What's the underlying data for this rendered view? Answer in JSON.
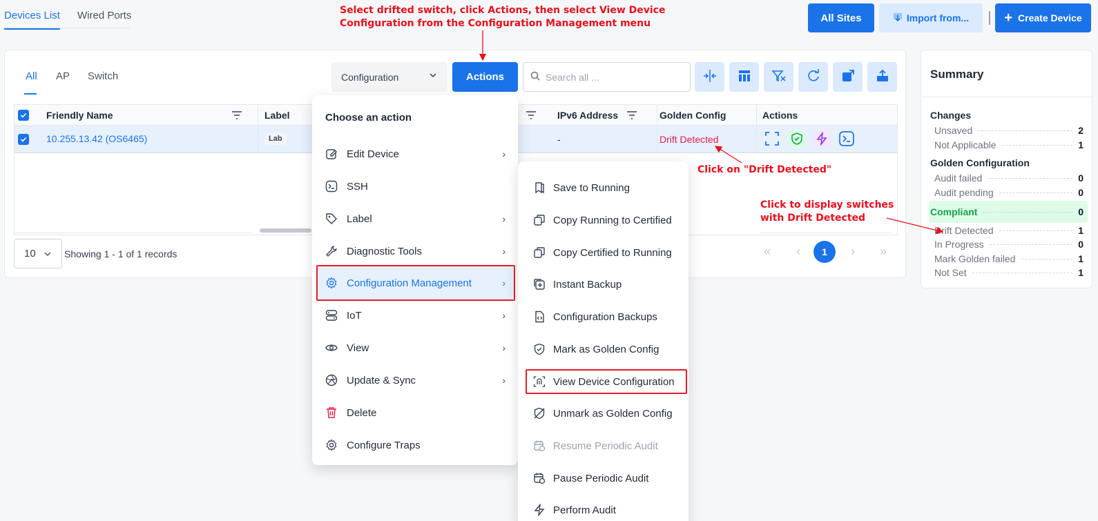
{
  "top_tabs": [
    {
      "label": "Devices List"
    },
    {
      "label": "Wired Ports"
    }
  ],
  "header_buttons": {
    "all_sites": "All Sites",
    "import": "Import from...",
    "create": "Create Device"
  },
  "sub_tabs": [
    {
      "label": "All"
    },
    {
      "label": "AP"
    },
    {
      "label": "Switch"
    }
  ],
  "toolbar": {
    "view_select": "Configuration",
    "actions_label": "Actions",
    "search_placeholder": "Search all ...",
    "tools": [
      "collapse-columns-icon",
      "columns-layout-icon",
      "clear-filter-icon",
      "refresh-icon",
      "open-external-icon",
      "export-icon"
    ]
  },
  "table": {
    "headers": {
      "friendly_name": "Friendly Name",
      "label": "Label",
      "ipv6": "IPv6 Address",
      "golden": "Golden Config",
      "actions": "Actions"
    },
    "rows": [
      {
        "friendly_name": "10.255.13.42 (OS6465)",
        "label": "Lab",
        "ipv6": "-",
        "golden": "Drift Detected"
      }
    ]
  },
  "pagination": {
    "page_size": "10",
    "showing": "Showing 1 - 1 of 1 records",
    "current_page": "1"
  },
  "summary": {
    "title": "Summary",
    "changes_heading": "Changes",
    "changes": [
      {
        "label": "Unsaved",
        "value": "2"
      },
      {
        "label": "Not Applicable",
        "value": "1"
      }
    ],
    "golden_heading": "Golden Configuration",
    "golden": [
      {
        "label": "Audit failed",
        "value": "0"
      },
      {
        "label": "Audit pending",
        "value": "0"
      },
      {
        "label": "Compliant",
        "value": "0"
      },
      {
        "label": "Drift Detected",
        "value": "1"
      },
      {
        "label": "In Progress",
        "value": "0"
      },
      {
        "label": "Mark Golden failed",
        "value": "1"
      },
      {
        "label": "Not Set",
        "value": "1"
      }
    ]
  },
  "action_menu": {
    "heading": "Choose an action",
    "items": [
      {
        "label": "Edit Device"
      },
      {
        "label": "SSH"
      },
      {
        "label": "Label"
      },
      {
        "label": "Diagnostic Tools"
      },
      {
        "label": "Configuration Management"
      },
      {
        "label": "IoT"
      },
      {
        "label": "View"
      },
      {
        "label": "Update & Sync"
      },
      {
        "label": "Delete"
      },
      {
        "label": "Configure Traps"
      }
    ]
  },
  "config_submenu": {
    "items": [
      {
        "label": "Save to Running"
      },
      {
        "label": "Copy Running to Certified"
      },
      {
        "label": "Copy Certified to Running"
      },
      {
        "label": "Instant Backup"
      },
      {
        "label": "Configuration Backups"
      },
      {
        "label": "Mark as Golden Config"
      },
      {
        "label": "View Device Configuration"
      },
      {
        "label": "Unmark as Golden Config"
      },
      {
        "label": "Resume Periodic Audit"
      },
      {
        "label": "Pause Periodic Audit"
      },
      {
        "label": "Perform Audit"
      }
    ]
  },
  "annotations": {
    "top_line1": "Select drifted switch, click Actions, then select View Device",
    "top_line2": "Configuration from the Configuration Management menu",
    "drift": "Click on \"Drift Detected\"",
    "summary_line1": "Click to display switches",
    "summary_line2": "with Drift Detected"
  },
  "colors": {
    "accent": "#1a73e8",
    "drift": "#e11d48",
    "annotation": "#e8101c",
    "compliant": "#16a34a"
  }
}
